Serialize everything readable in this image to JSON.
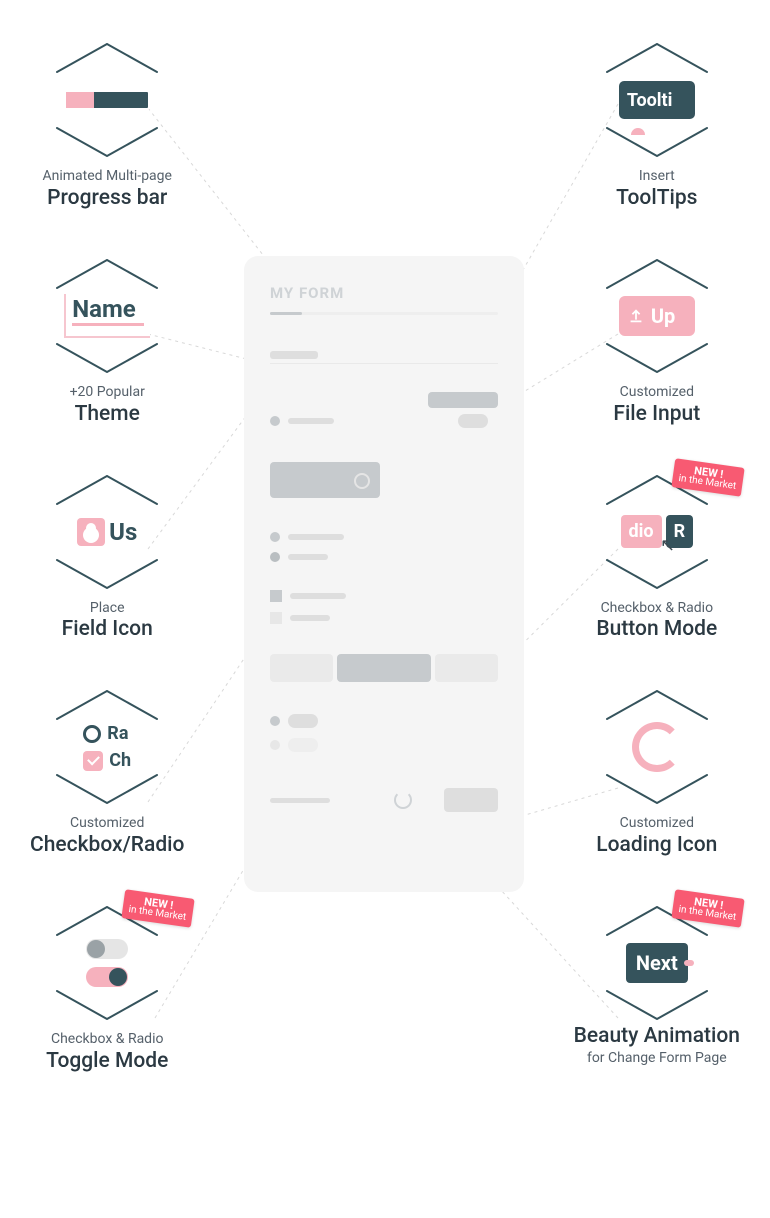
{
  "form": {
    "title": "MY FORM"
  },
  "left": {
    "progress": {
      "small": "Animated Multi-page",
      "big": "Progress bar"
    },
    "theme": {
      "small": "+20 Popular",
      "big": "Theme",
      "sample": "Name"
    },
    "fieldicon": {
      "small": "Place",
      "big": "Field Icon",
      "sample": "Us"
    },
    "checkbox": {
      "small": "Customized",
      "big": "Checkbox/Radio",
      "ra": "Ra",
      "ch": "Ch"
    },
    "toggle": {
      "small": "Checkbox & Radio",
      "big": "Toggle Mode"
    }
  },
  "right": {
    "tooltip": {
      "small": "Insert",
      "big": "ToolTips",
      "sample": "Toolti"
    },
    "upload": {
      "small": "Customized",
      "big": "File Input",
      "sample": "Up"
    },
    "buttonmode": {
      "small": "Checkbox & Radio",
      "big": "Button Mode",
      "a": "dio",
      "b": "R"
    },
    "loading": {
      "small": "Customized",
      "big": "Loading Icon"
    },
    "animation": {
      "big": "Beauty Animation",
      "small": "for Change Form Page",
      "sample": "Next"
    }
  },
  "badge": {
    "line1": "NEW !",
    "line2": "in the Market"
  }
}
